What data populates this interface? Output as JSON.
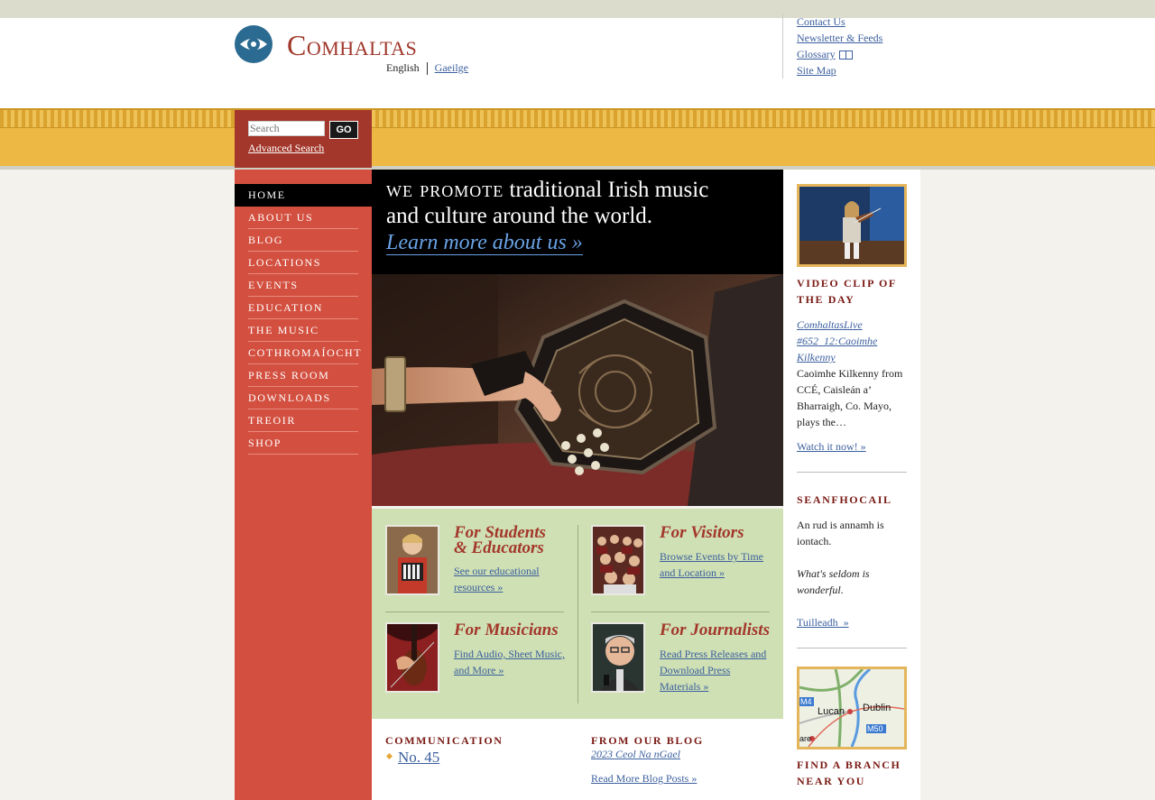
{
  "site": {
    "logo_text": "Comhaltas"
  },
  "language": {
    "current": "English",
    "alternate": "Gaeilge"
  },
  "utility_links": {
    "contact": "Contact Us",
    "newsletter": "Newsletter & Feeds",
    "glossary": "Glossary",
    "sitemap": "Site Map"
  },
  "search": {
    "placeholder": "Search",
    "go_label": "GO",
    "advanced_label": "Advanced Search"
  },
  "nav": {
    "items": [
      {
        "label": "HOME",
        "active": true
      },
      {
        "label": "ABOUT US"
      },
      {
        "label": "BLOG"
      },
      {
        "label": "LOCATIONS"
      },
      {
        "label": "EVENTS"
      },
      {
        "label": "EDUCATION"
      },
      {
        "label": "THE MUSIC"
      },
      {
        "label": "COTHROMAÍOCHT"
      },
      {
        "label": "PRESS ROOM"
      },
      {
        "label": "DOWNLOADS"
      },
      {
        "label": "TREOIR"
      },
      {
        "label": "SHOP"
      }
    ]
  },
  "promo": {
    "line1_sc": "we promote",
    "line1_rest": "traditional Irish music",
    "line2": "and culture around the world.",
    "link": "Learn more about us »"
  },
  "audience": {
    "students": {
      "title_line1": "For Students",
      "title_line2": "& Educators",
      "link": "See our educational resources »"
    },
    "visitors": {
      "title": "For Visitors",
      "link": "Browse Events by Time and Location »"
    },
    "musicians": {
      "title": "For Musicians",
      "link": "Find Audio, Sheet Music, and More »"
    },
    "journalists": {
      "title": "For Journalists",
      "link": "Read Press Releases and Download Press Materials »"
    }
  },
  "communication": {
    "heading": "COMMUNICATION",
    "item": "No. 45"
  },
  "blog": {
    "heading": "FROM OUR BLOG",
    "post": "2023 Ceol Na nGael",
    "more": "Read More Blog Posts »"
  },
  "video": {
    "heading": "VIDEO CLIP OF THE DAY",
    "title": "ComhaltasLive #652_12:Caoimhe Kilkenny",
    "description": "Caoimhe Kilkenny from CCÉ, Caisleán a’ Bharraigh, Co. Mayo, plays the…",
    "watch": "Watch it now! »"
  },
  "proverb": {
    "heading": "SEANFHOCAIL",
    "irish": "An rud is annamh is iontach.",
    "english_main": "What's seldom is wonderful",
    "english_end": ".",
    "more": "Tuilleadh  »"
  },
  "branch": {
    "heading": "FIND A BRANCH NEAR YOU",
    "map_labels": {
      "m4": "M4",
      "dublin": "Dublin",
      "lucan": "Lucan",
      "m50": "M50",
      "are": "are"
    }
  },
  "colors": {
    "brand_red": "#a3372b",
    "nav_red": "#d35040",
    "banner_gold": "#edb843",
    "audience_green": "#cfe0b4",
    "heading_maroon": "#7a1a14",
    "link_blue": "#3b5f9e"
  }
}
